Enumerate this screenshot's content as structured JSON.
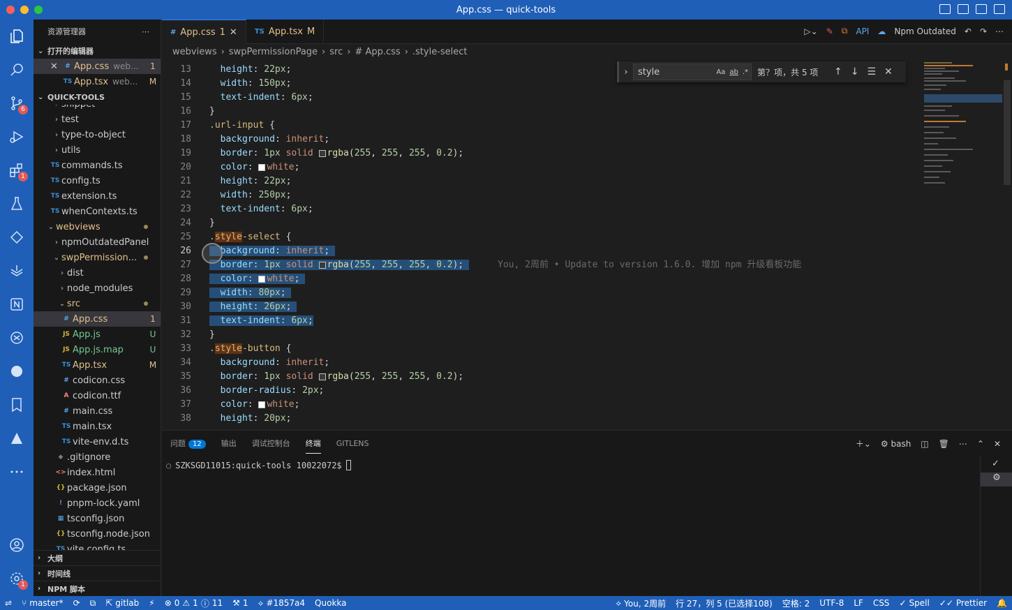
{
  "window": {
    "title": "App.css — quick-tools"
  },
  "activity": {
    "scm_badge": "6",
    "ext_badge": "1",
    "settings_badge": "1"
  },
  "sidebar": {
    "header": "资源管理器",
    "open_editors_title": "打开的编辑器",
    "open_editors": [
      {
        "icon": "#",
        "name": "App.css",
        "desc": "web...",
        "status": "1"
      },
      {
        "icon": "TS",
        "name": "App.tsx",
        "desc": "web...",
        "status": "M"
      }
    ],
    "workspace_title": "QUICK-TOOLS",
    "tree": [
      {
        "name": "snippet",
        "type": "folder"
      },
      {
        "name": "test",
        "type": "folder"
      },
      {
        "name": "type-to-object",
        "type": "folder"
      },
      {
        "name": "utils",
        "type": "folder"
      },
      {
        "name": "commands.ts",
        "icon": "TS"
      },
      {
        "name": "config.ts",
        "icon": "TS"
      },
      {
        "name": "extension.ts",
        "icon": "TS"
      },
      {
        "name": "whenContexts.ts",
        "icon": "TS"
      },
      {
        "name": "webviews",
        "type": "folder-open"
      },
      {
        "name": "npmOutdatedPanel",
        "type": "folder"
      },
      {
        "name": "swpPermission...",
        "type": "folder-open"
      },
      {
        "name": "dist",
        "type": "folder"
      },
      {
        "name": "node_modules",
        "type": "folder"
      },
      {
        "name": "src",
        "type": "folder-open"
      },
      {
        "name": "App.css",
        "icon": "#",
        "status": "1"
      },
      {
        "name": "App.js",
        "icon": "JS",
        "status": "U"
      },
      {
        "name": "App.js.map",
        "icon": "JS",
        "status": "U"
      },
      {
        "name": "App.tsx",
        "icon": "TS",
        "status": "M"
      },
      {
        "name": "codicon.css",
        "icon": "#"
      },
      {
        "name": "codicon.ttf",
        "icon": "A"
      },
      {
        "name": "main.css",
        "icon": "#"
      },
      {
        "name": "main.tsx",
        "icon": "TS"
      },
      {
        "name": "vite-env.d.ts",
        "icon": "TS"
      },
      {
        "name": ".gitignore",
        "icon": "◆"
      },
      {
        "name": "index.html",
        "icon": "<>"
      },
      {
        "name": "package.json",
        "icon": "{}"
      },
      {
        "name": "pnpm-lock.yaml",
        "icon": "!"
      },
      {
        "name": "tsconfig.json",
        "icon": "▦"
      },
      {
        "name": "tsconfig.node.json",
        "icon": "{}"
      },
      {
        "name": "vite.config.ts",
        "icon": "TS"
      }
    ],
    "bottom_sections": [
      "大纲",
      "时间线",
      "NPM 脚本"
    ]
  },
  "tabs": [
    {
      "icon": "#",
      "name": "App.css",
      "status": "1"
    },
    {
      "icon": "TS",
      "name": "App.tsx",
      "status": "M"
    }
  ],
  "tab_actions": {
    "npm_label": "Npm Outdated"
  },
  "breadcrumb": [
    "webviews",
    "swpPermissionPage",
    "src",
    "# App.css",
    ".style-select"
  ],
  "find": {
    "query": "style",
    "count": "第？项，共 5 项",
    "opt_case": "Aa",
    "opt_word": "ab",
    "opt_regex": ".*"
  },
  "editor": {
    "blame": "You, 2周前 • Update to version 1.6.0. 增加 npm 升级看板功能",
    "lines": [
      "13",
      "14",
      "15",
      "16",
      "17",
      "18",
      "19",
      "20",
      "21",
      "22",
      "23",
      "24",
      "25",
      "26",
      "27",
      "28",
      "29",
      "30",
      "31",
      "32",
      "33",
      "34",
      "35",
      "36",
      "37",
      "38"
    ]
  },
  "panel": {
    "tabs": [
      "问题",
      "输出",
      "调试控制台",
      "终端",
      "GITLENS"
    ],
    "problems_count": "12",
    "shell": "bash",
    "prompt": "SZKSGD11015:quick-tools 10022072$"
  },
  "status": {
    "branch": "master*",
    "remote": "gitlab",
    "errors": "0",
    "warnings": "1",
    "infos": "11",
    "ports": "1",
    "commit": "#1857a4",
    "quokka": "Quokka",
    "blame": "You, 2周前",
    "position": "行 27，列 5 (已选择108)",
    "spaces": "空格: 2",
    "encoding": "UTF-8",
    "eol": "LF",
    "language": "CSS",
    "spell": "Spell",
    "prettier": "Prettier"
  },
  "colors": {
    "accent": "#1f5fb8",
    "selection": "#264f78",
    "editor_bg": "#1e1e1e"
  }
}
